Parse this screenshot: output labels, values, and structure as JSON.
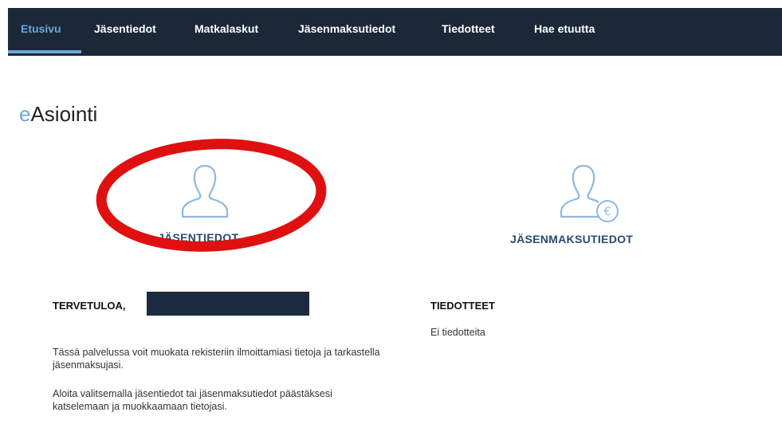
{
  "nav": {
    "items": [
      {
        "label": "Etusivu",
        "active": true
      },
      {
        "label": "Jäsentiedot"
      },
      {
        "label": "Matkalaskut"
      },
      {
        "label": "Jäsenmaksutiedot"
      },
      {
        "label": "Tiedotteet"
      },
      {
        "label": "Hae etuutta"
      }
    ]
  },
  "page": {
    "title_prefix": "e",
    "title_rest": "Asiointi"
  },
  "cards": {
    "member_info": {
      "label": "JÄSENTIEDOT",
      "icon": "user-icon"
    },
    "membership_fees": {
      "label": "JÄSENMAKSUTIEDOT",
      "icon": "user-euro-icon"
    }
  },
  "welcome": {
    "heading": "TERVETULOA,",
    "paragraph1": "Tässä palvelussa voit muokata rekisteriin ilmoittamiasi tietoja ja tarkastella jäsenmaksujasi.",
    "paragraph2": "Aloita valitsemalla jäsentiedot tai jäsenmaksutiedot päästäksesi katselemaan ja muokkaamaan tietojasi."
  },
  "announcements": {
    "heading": "TIEDOTTEET",
    "empty_text": "Ei tiedotteita"
  },
  "colors": {
    "nav_background": "#1b2838",
    "accent": "#6aa8dc",
    "card_label": "#2b4a6f",
    "highlight": "#e01010",
    "redaction": "#1b2a40"
  }
}
